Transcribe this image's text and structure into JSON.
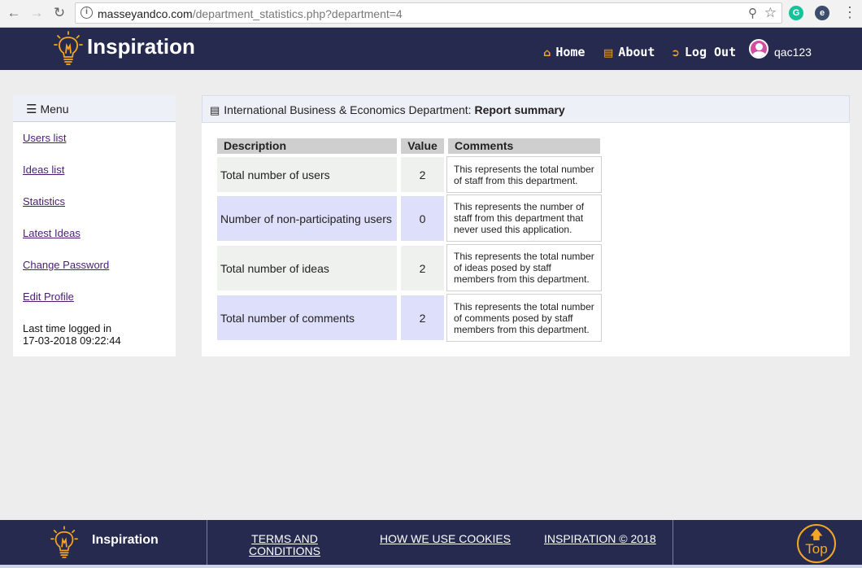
{
  "browser": {
    "url_host": "masseyandco.com",
    "url_path": "/department_statistics.php?department=4",
    "back_icon": "arrow-left-icon",
    "forward_icon": "arrow-right-icon",
    "reload_icon": "reload-icon"
  },
  "header": {
    "brand": "Inspiration",
    "nav": {
      "home": "Home",
      "about": "About",
      "logout": "Log Out"
    },
    "username": "qac123",
    "accent_color": "#f5a623",
    "bar_color": "#262a4f"
  },
  "sidebar": {
    "title": "Menu",
    "links": [
      "Users list",
      "Ideas list",
      "Statistics",
      "Latest Ideas",
      "Change Password",
      "Edit Profile"
    ],
    "last_login_label": "Last time logged in",
    "last_login_time": "17-03-2018 09:22:44"
  },
  "main": {
    "department": "International Business & Economics Department:",
    "title": "Report summary",
    "headers": {
      "description": "Description",
      "value": "Value",
      "comments": "Comments"
    },
    "rows": [
      {
        "description": "Total number of users",
        "value": "2",
        "comment": "This represents the total number of staff from this department."
      },
      {
        "description": "Number of non-participating users",
        "value": "0",
        "comment": "This represents the number of staff from this department that never used this application."
      },
      {
        "description": "Total number of ideas",
        "value": "2",
        "comment": "This represents the total number of ideas posed by staff members from this department."
      },
      {
        "description": "Total number of comments",
        "value": "2",
        "comment": "This represents the total number of comments posed by staff members from this department."
      }
    ]
  },
  "footer": {
    "brand": "Inspiration",
    "terms_line1": "TERMS AND",
    "terms_line2": "CONDITIONS",
    "cookies": "HOW WE USE COOKIES",
    "copyright": "INSPIRATION © 2018",
    "top_label": "Top"
  }
}
